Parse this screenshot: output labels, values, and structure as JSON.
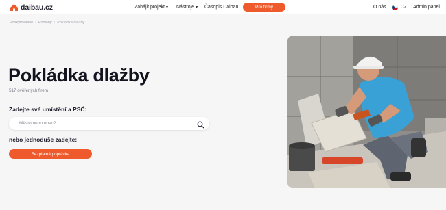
{
  "header": {
    "logo_text": "daibau.cz",
    "nav": [
      {
        "label": "Zahájit projekt",
        "has_dropdown": true
      },
      {
        "label": "Nástroje",
        "has_dropdown": true
      },
      {
        "label": "Časopis Daibau",
        "has_dropdown": false
      }
    ],
    "cta_label": "Pro firmy",
    "about_label": "O nás",
    "language_label": "CZ",
    "admin_label": "Admin panel"
  },
  "breadcrumb": [
    "Poskytovatelé",
    "Podlahy",
    "Pokládka dlažby"
  ],
  "hero": {
    "title": "Pokládka dlažby",
    "subtitle": "517 ověřených firem",
    "location_label": "Zadejte své umístění a PSČ:",
    "search_placeholder": "Město nebo obec?",
    "alt_label": "nebo jednoduše zadejte:",
    "cta_label": "Bezplatná poptávka"
  },
  "colors": {
    "accent": "#ef5a2c",
    "background": "#f6f6f7",
    "text": "#14141f"
  },
  "icons": {
    "logo": "house-logo-icon",
    "search": "search-icon",
    "dropdown": "chevron-down-icon",
    "flag": "czech-flag-icon"
  }
}
